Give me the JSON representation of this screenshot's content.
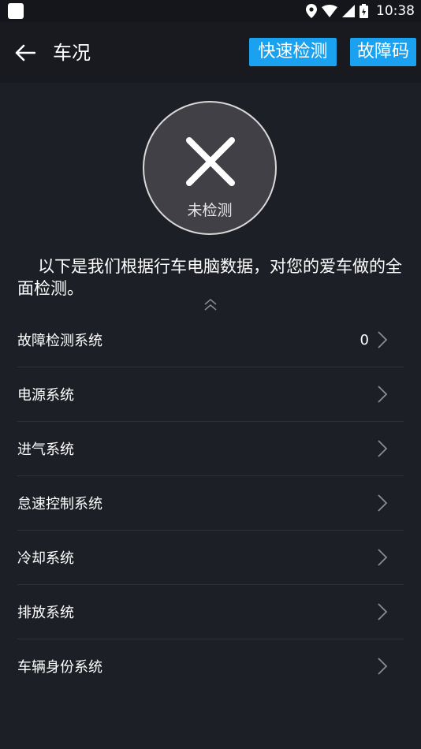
{
  "status_bar": {
    "time": "10:38",
    "icons": [
      "notification-square-icon",
      "location-icon",
      "wifi-icon",
      "signal-icon",
      "battery-icon"
    ]
  },
  "header": {
    "title": "车况",
    "quick_check_label": "快速检测",
    "fault_code_label": "故障码",
    "accent_color": "#1aa1f0"
  },
  "status": {
    "label": "未检测",
    "icon": "close-icon"
  },
  "intro": "以下是我们根据行车电脑数据，对您的爱车做的全面检测。",
  "systems": [
    {
      "label": "故障检测系统",
      "count": "0"
    },
    {
      "label": "电源系统",
      "count": ""
    },
    {
      "label": "进气系统",
      "count": ""
    },
    {
      "label": "怠速控制系统",
      "count": ""
    },
    {
      "label": "冷却系统",
      "count": ""
    },
    {
      "label": "排放系统",
      "count": ""
    },
    {
      "label": "车辆身份系统",
      "count": ""
    }
  ]
}
